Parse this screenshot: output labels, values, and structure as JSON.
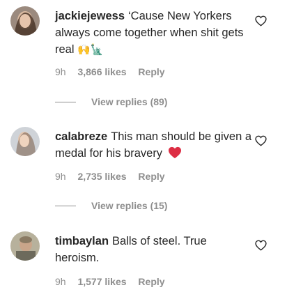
{
  "comments": [
    {
      "username": "jackiejewess",
      "text": "‘Cause New Yorkers always come together when shit gets real",
      "emoji": "🙌🗽",
      "time": "9h",
      "likes": "3,866 likes",
      "reply": "Reply",
      "view_replies": "View replies (89)",
      "avatar_icon": "user-avatar",
      "like_icon": "heart-outline-icon"
    },
    {
      "username": "calabreze",
      "text": "This man should be given a medal for his bravery",
      "emoji": "❤️",
      "time": "9h",
      "likes": "2,735 likes",
      "reply": "Reply",
      "view_replies": "View replies (15)",
      "avatar_icon": "user-avatar",
      "like_icon": "heart-outline-icon"
    },
    {
      "username": "timbaylan",
      "text": "Balls of steel. True heroism.",
      "time": "9h",
      "likes": "1,577 likes",
      "reply": "Reply",
      "avatar_icon": "user-avatar",
      "like_icon": "heart-outline-icon"
    }
  ],
  "colors": {
    "text": "#262626",
    "muted": "#8e8e8e",
    "heart": "#ed4956"
  }
}
